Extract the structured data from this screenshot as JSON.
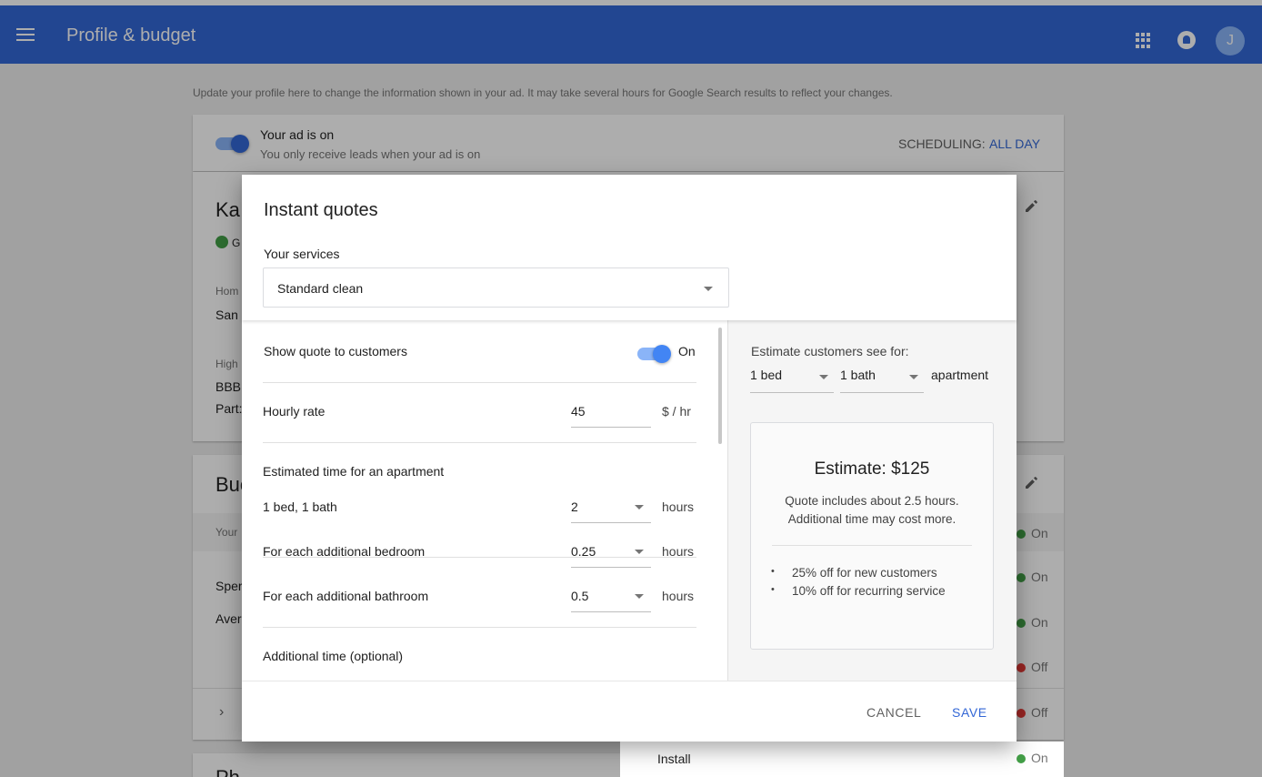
{
  "topbar": {
    "title": "Profile & budget",
    "avatar_initial": "J",
    "color": "#3367d6"
  },
  "page": {
    "info": "Update your profile here to change the information shown in your ad. It may take several hours for Google Search results to reflect your changes.",
    "ad_status": {
      "title": "Your ad is on",
      "subtitle": "You only receive leads when your ad is on",
      "enabled": true
    },
    "scheduling": {
      "label": "SCHEDULING:",
      "value": "ALL DAY"
    },
    "profile_peek": {
      "name": "Ka",
      "badge": "G",
      "home_label": "Hom",
      "home_value": "San",
      "high_label": "High",
      "line1": "BBB",
      "line2": "Part:"
    },
    "budget_peek": {
      "title": "Buc",
      "row1": "Your",
      "spend": "Sper",
      "average": "Aver"
    },
    "photo_peek": {
      "title": "Ph"
    },
    "statuses": [
      {
        "label": "On",
        "color": "#43a047"
      },
      {
        "label": "On",
        "color": "#43a047"
      },
      {
        "label": "On",
        "color": "#43a047"
      },
      {
        "label": "Off",
        "color": "#e53935"
      },
      {
        "label": "Off",
        "color": "#e53935"
      },
      {
        "label": "On",
        "color": "#43a047"
      }
    ],
    "install_label": "Install"
  },
  "dialog": {
    "title": "Instant quotes",
    "services_label": "Your services",
    "service_selected": "Standard clean",
    "show_quote": {
      "label": "Show quote to customers",
      "state": "On",
      "enabled": true
    },
    "hourly_rate": {
      "label": "Hourly rate",
      "value": "45",
      "unit": "$ / hr"
    },
    "estimated_time": {
      "heading": "Estimated time for an apartment",
      "rows": [
        {
          "label": "1 bed, 1 bath",
          "value": "2",
          "unit": "hours"
        },
        {
          "label": "For each additional bedroom",
          "value": "0.25",
          "unit": "hours"
        },
        {
          "label": "For each additional bathroom",
          "value": "0.5",
          "unit": "hours"
        }
      ]
    },
    "additional_heading": "Additional time (optional)",
    "preview": {
      "label": "Estimate customers see for:",
      "beds": "1 bed",
      "baths": "1 bath",
      "type": "apartment",
      "estimate": "Estimate: $125",
      "note_line1": "Quote includes about 2.5 hours.",
      "note_line2": "Additional time may cost more.",
      "discounts": [
        "25% off for new customers",
        "10% off for recurring service"
      ]
    },
    "cancel_label": "CANCEL",
    "save_label": "SAVE",
    "accent": "#4285f4"
  }
}
